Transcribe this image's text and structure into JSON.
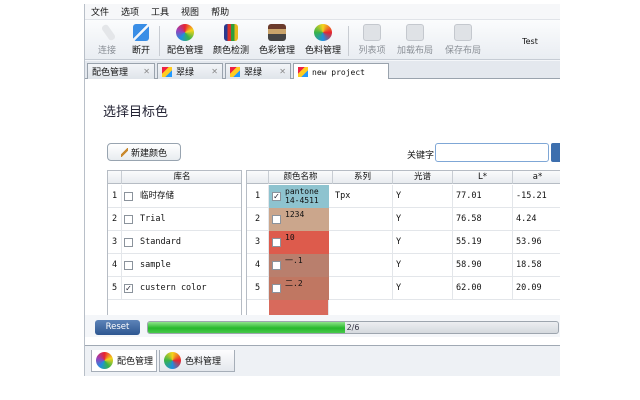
{
  "menu": [
    "文件",
    "选项",
    "工具",
    "视图",
    "帮助"
  ],
  "toolbar": [
    {
      "label": "连接",
      "icon": "connect-icon",
      "enabled": false
    },
    {
      "label": "断开",
      "icon": "disconnect-icon",
      "enabled": true
    },
    {
      "label": "配色管理",
      "icon": "color-matching-icon",
      "enabled": true
    },
    {
      "label": "颜色检测",
      "icon": "color-detect-icon",
      "enabled": true
    },
    {
      "label": "色彩管理",
      "icon": "color-management-icon",
      "enabled": true
    },
    {
      "label": "色料管理",
      "icon": "colorant-management-icon",
      "enabled": true
    },
    {
      "label": "列表项",
      "icon": "list-items-icon",
      "enabled": false
    },
    {
      "label": "加载布局",
      "icon": "load-layout-icon",
      "enabled": false
    },
    {
      "label": "保存布局",
      "icon": "save-layout-icon",
      "enabled": false
    },
    {
      "label": "Test",
      "icon": "",
      "enabled": true
    }
  ],
  "tabs": [
    {
      "label": "配色管理",
      "icon": "",
      "active": false
    },
    {
      "label": "翠绿",
      "icon": "palette-icon",
      "active": false
    },
    {
      "label": "翠绿",
      "icon": "palette-icon",
      "active": false
    },
    {
      "label": "new project",
      "icon": "palette-icon",
      "active": true
    }
  ],
  "page": {
    "title": "选择目标色",
    "new_color_button": "新建颜色",
    "keyword_label": "关键字",
    "keyword_value": ""
  },
  "library_table": {
    "header": "库名",
    "rows": [
      {
        "num": "1",
        "checked": false,
        "name": "临时存储"
      },
      {
        "num": "2",
        "checked": false,
        "name": "Trial"
      },
      {
        "num": "3",
        "checked": false,
        "name": "Standard"
      },
      {
        "num": "4",
        "checked": false,
        "name": "sample"
      },
      {
        "num": "5",
        "checked": true,
        "name": "custern color"
      }
    ]
  },
  "color_table": {
    "headers": [
      "颜色名称",
      "系列",
      "光谱",
      "L*",
      "a*"
    ],
    "rows": [
      {
        "num": "1",
        "checked": true,
        "name": "pantone\n14-4511",
        "swatch": "#8ec3cf",
        "series": "Tpx",
        "spectrum": "Y",
        "L": "77.01",
        "a": "-15.21"
      },
      {
        "num": "2",
        "checked": false,
        "name": "1234",
        "swatch": "#cba68c",
        "series": "",
        "spectrum": "Y",
        "L": "76.58",
        "a": "4.24"
      },
      {
        "num": "3",
        "checked": false,
        "name": "10",
        "swatch": "#dd5b4c",
        "series": "",
        "spectrum": "Y",
        "L": "55.19",
        "a": "53.96"
      },
      {
        "num": "4",
        "checked": false,
        "name": "一.1",
        "swatch": "#b97f6d",
        "series": "",
        "spectrum": "Y",
        "L": "58.90",
        "a": "18.58"
      },
      {
        "num": "5",
        "checked": false,
        "name": "二.2",
        "swatch": "#c07762",
        "series": "",
        "spectrum": "Y",
        "L": "62.00",
        "a": "20.09"
      }
    ]
  },
  "bottom": {
    "reset_label": "Reset",
    "progress_text": "2/6",
    "progress_fraction": 0.48
  },
  "bottom_tabs": [
    {
      "label": "配色管理",
      "icon": "color-matching-icon"
    },
    {
      "label": "色料管理",
      "icon": "colorant-management-icon"
    }
  ]
}
